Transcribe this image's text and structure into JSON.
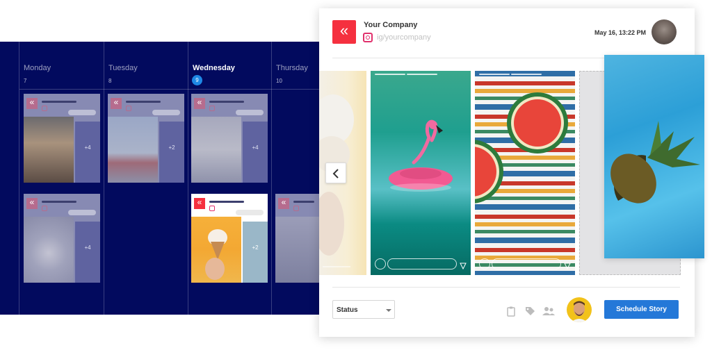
{
  "calendar": {
    "days": [
      {
        "name": "Monday",
        "num": "7"
      },
      {
        "name": "Tuesday",
        "num": "8"
      },
      {
        "name": "Wednesday",
        "num": "9",
        "active": true
      },
      {
        "name": "Thursday",
        "num": "10"
      }
    ],
    "cards": [
      {
        "more": "+4"
      },
      {
        "more": "+2"
      },
      {
        "more": "+4"
      },
      {
        "more": "+4"
      },
      {
        "more": "+2"
      },
      {
        "more": ""
      }
    ]
  },
  "panel": {
    "company": "Your Company",
    "handle": "ig/yourcompany",
    "date": "May 16, 13:22 PM",
    "status_label": "Status",
    "schedule_label": "Schedule Story"
  },
  "colors": {
    "calendar_bg": "#020a5e",
    "brand_red": "#f5303f",
    "accent_blue": "#2478d8",
    "today_blue": "#1e88e5"
  },
  "icons": [
    "logo-icon",
    "instagram-icon",
    "chevron-left-icon",
    "camera-icon",
    "send-icon",
    "clipboard-icon",
    "tag-icon",
    "people-icon",
    "caret-down-icon"
  ]
}
